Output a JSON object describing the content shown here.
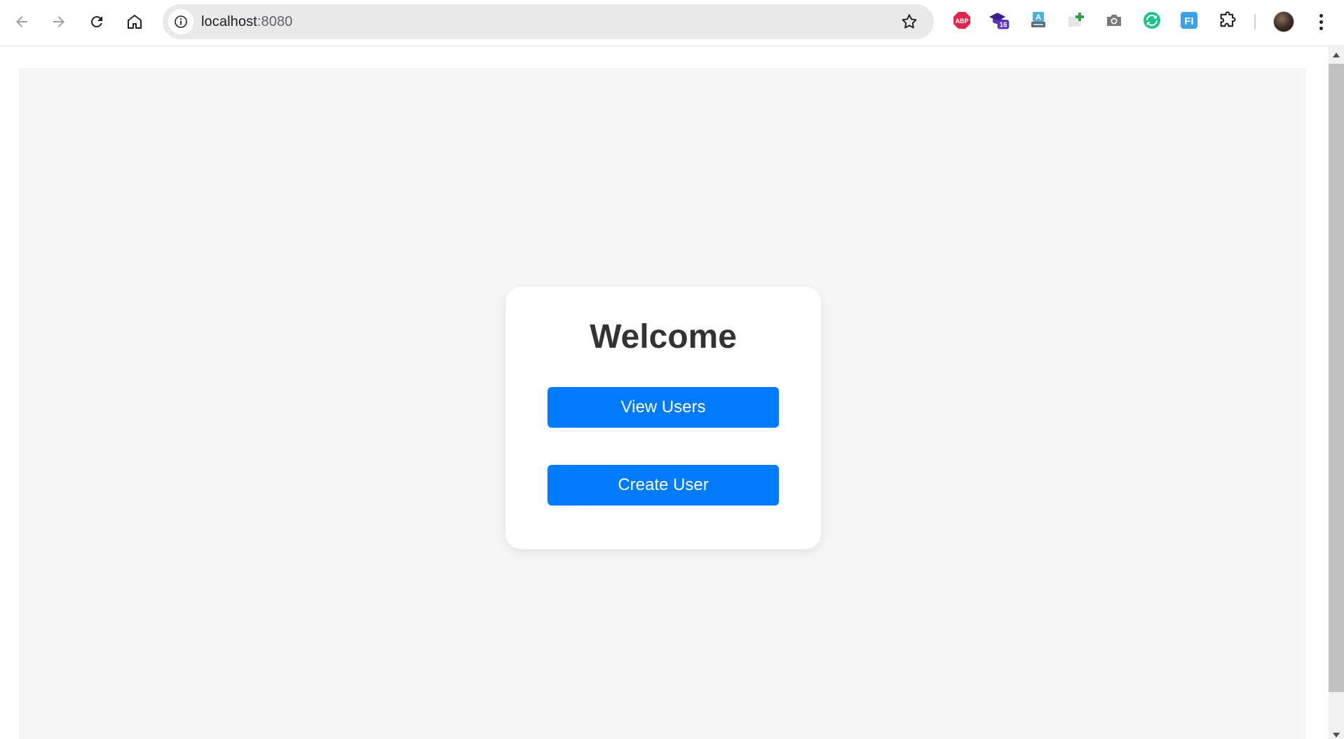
{
  "browser": {
    "url_host": "localhost",
    "url_port": ":8080",
    "extensions": [
      {
        "name": "adblock-plus-icon",
        "label": "ABP",
        "color": "#e0264a"
      },
      {
        "name": "graduation-cap-icon",
        "badge": "16",
        "color": "#5b2fbf"
      },
      {
        "name": "translate-icon",
        "label": "A",
        "color": "#4a90c2"
      },
      {
        "name": "add-note-icon",
        "color": "#2e9e3e"
      },
      {
        "name": "camera-icon",
        "color": "#7a7a7a"
      },
      {
        "name": "sync-icon",
        "color": "#1ec28b"
      },
      {
        "name": "fi-icon",
        "label": "FI",
        "color": "#3aa0e8"
      },
      {
        "name": "extensions-puzzle-icon",
        "color": "#202124"
      }
    ]
  },
  "page": {
    "title": "Welcome",
    "buttons": {
      "view_users": "View Users",
      "create_user": "Create User"
    },
    "accent_color": "#007bff"
  }
}
